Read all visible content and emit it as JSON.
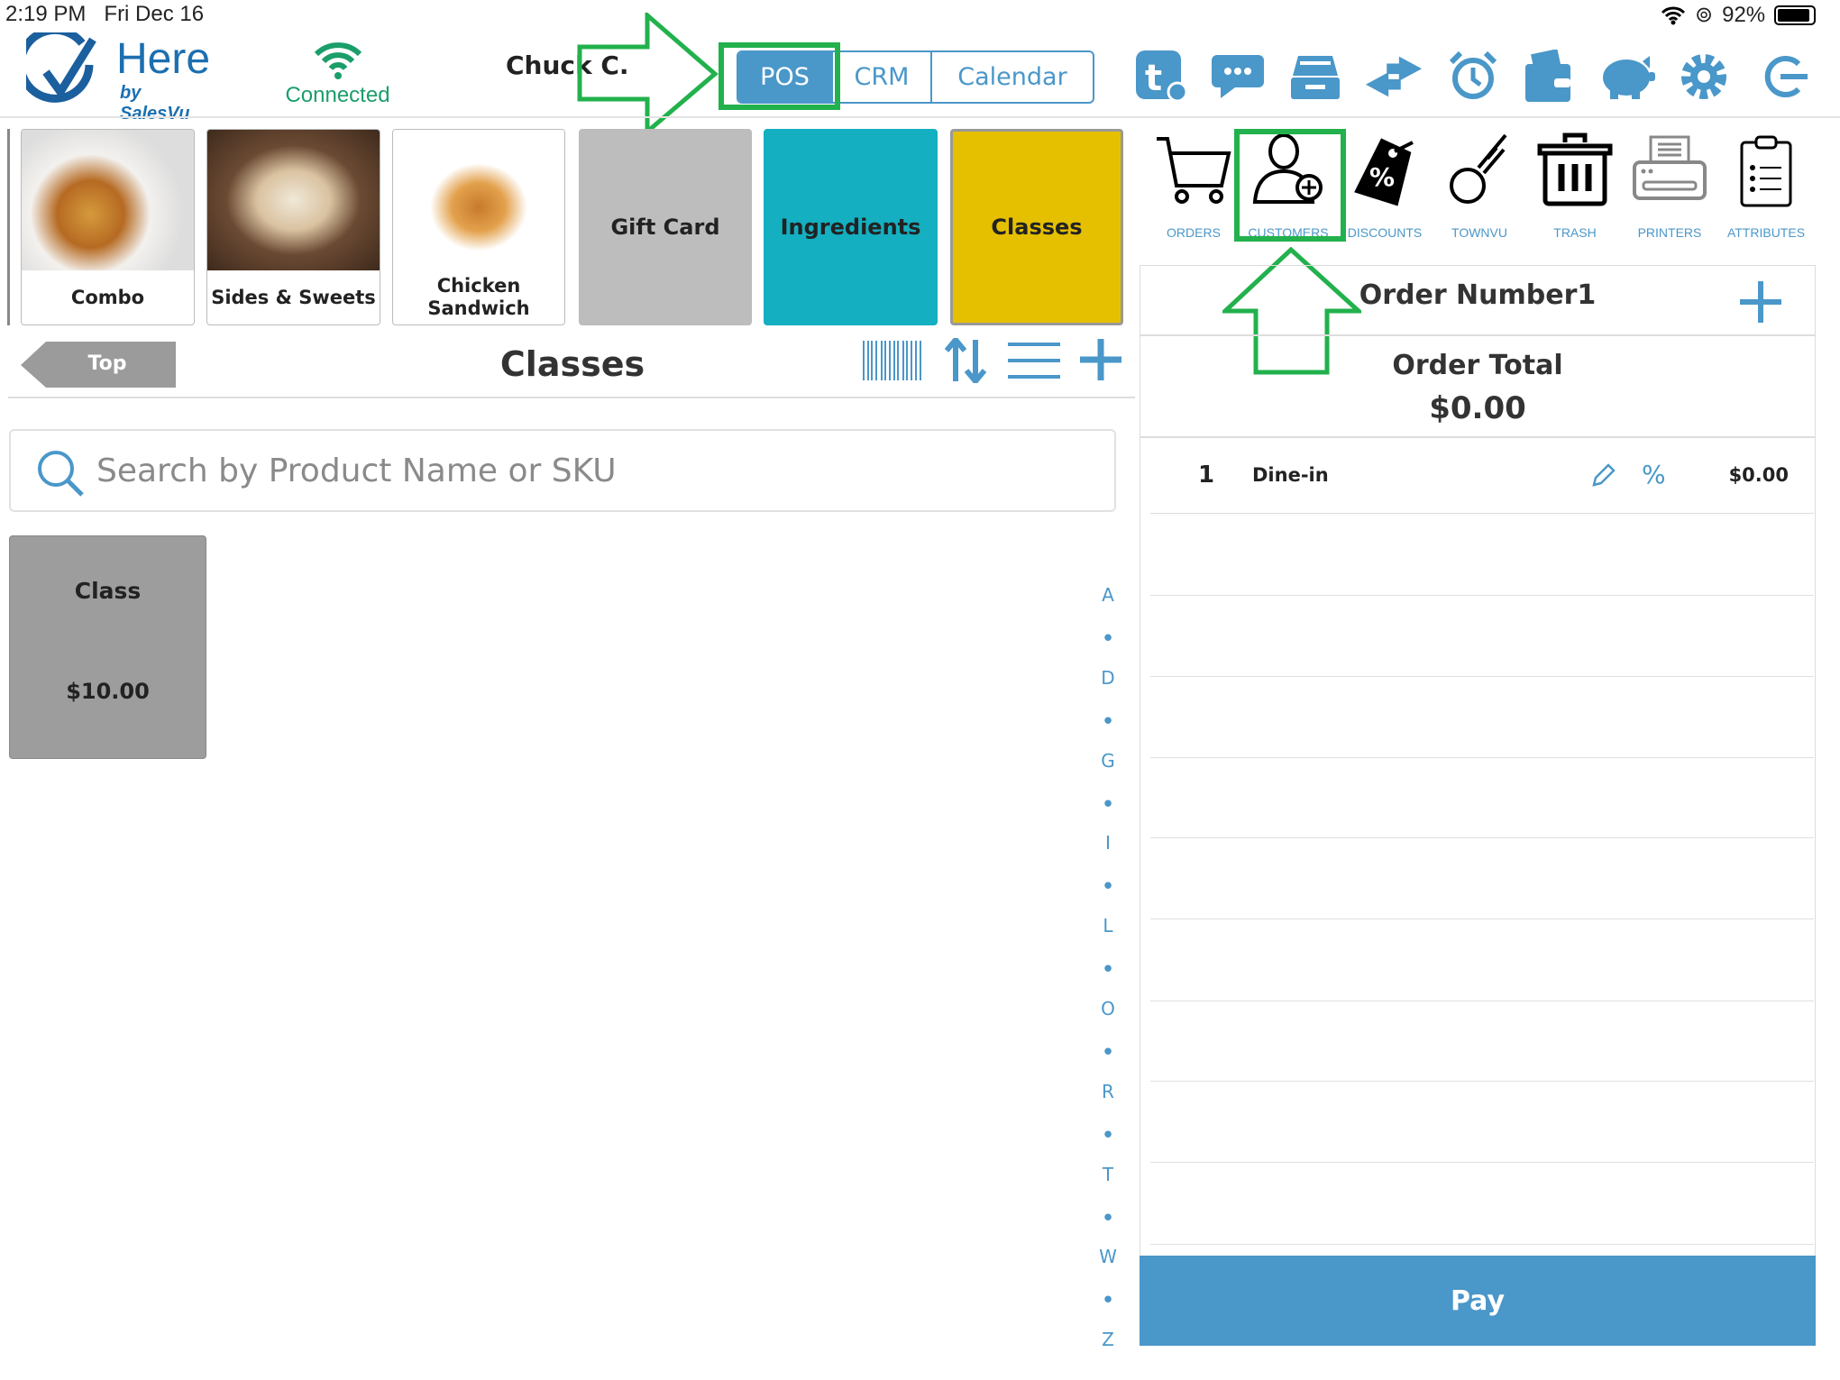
{
  "status_bar": {
    "time": "2:19 PM",
    "date": "Fri Dec 16",
    "battery": "92%"
  },
  "header": {
    "logo_text": "Here",
    "logo_sub": "by SalesVu",
    "connection": "Connected",
    "user": "Chuck C.",
    "tabs": [
      {
        "label": "POS",
        "active": true
      },
      {
        "label": "CRM"
      },
      {
        "label": "Calendar"
      }
    ],
    "icons": [
      "townvu-settings-icon",
      "chat-icon",
      "cash-drawer-icon",
      "transfer-icon",
      "alarm-clock-icon",
      "wallet-icon",
      "piggy-bank-icon",
      "settings-gear-icon",
      "logout-icon"
    ]
  },
  "categories": [
    {
      "label": "Combo",
      "image": true
    },
    {
      "label": "Sides & Sweets",
      "image": true
    },
    {
      "label": "Chicken Sandwich",
      "image": true
    },
    {
      "label": "Gift Card",
      "color": "#bdbdbd"
    },
    {
      "label": "Ingredients",
      "color": "#14afc0"
    },
    {
      "label": "Classes",
      "color": "#e5c000"
    }
  ],
  "actions": [
    {
      "label": "ORDERS",
      "icon": "cart-icon"
    },
    {
      "label": "CUSTOMERS",
      "icon": "add-customer-icon"
    },
    {
      "label": "DISCOUNTS",
      "icon": "discount-tag-icon"
    },
    {
      "label": "TOWNVU",
      "icon": "townvu-icon"
    },
    {
      "label": "TRASH",
      "icon": "trash-icon"
    },
    {
      "label": "PRINTERS",
      "icon": "printer-icon"
    },
    {
      "label": "ATTRIBUTES",
      "icon": "clipboard-icon"
    }
  ],
  "products_panel": {
    "back_label": "Top",
    "title": "Classes",
    "search_placeholder": "Search by Product Name or SKU",
    "products": [
      {
        "name": "Class",
        "price": "$10.00"
      }
    ],
    "index": [
      "A",
      "•",
      "D",
      "•",
      "G",
      "•",
      "I",
      "•",
      "L",
      "•",
      "O",
      "•",
      "R",
      "•",
      "T",
      "•",
      "W",
      "•",
      "Z"
    ]
  },
  "order": {
    "title": "Order Number1",
    "total_label": "Order Total",
    "total": "$0.00",
    "items": [
      {
        "qty": "1",
        "name": "Dine-in",
        "discount_symbol": "%",
        "price": "$0.00"
      }
    ],
    "pay_label": "Pay"
  },
  "colors": {
    "accent": "#4a97c9",
    "highlight": "#22b14c",
    "teal": "#14afc0",
    "yellow": "#e5c000",
    "gray": "#bdbdbd"
  }
}
